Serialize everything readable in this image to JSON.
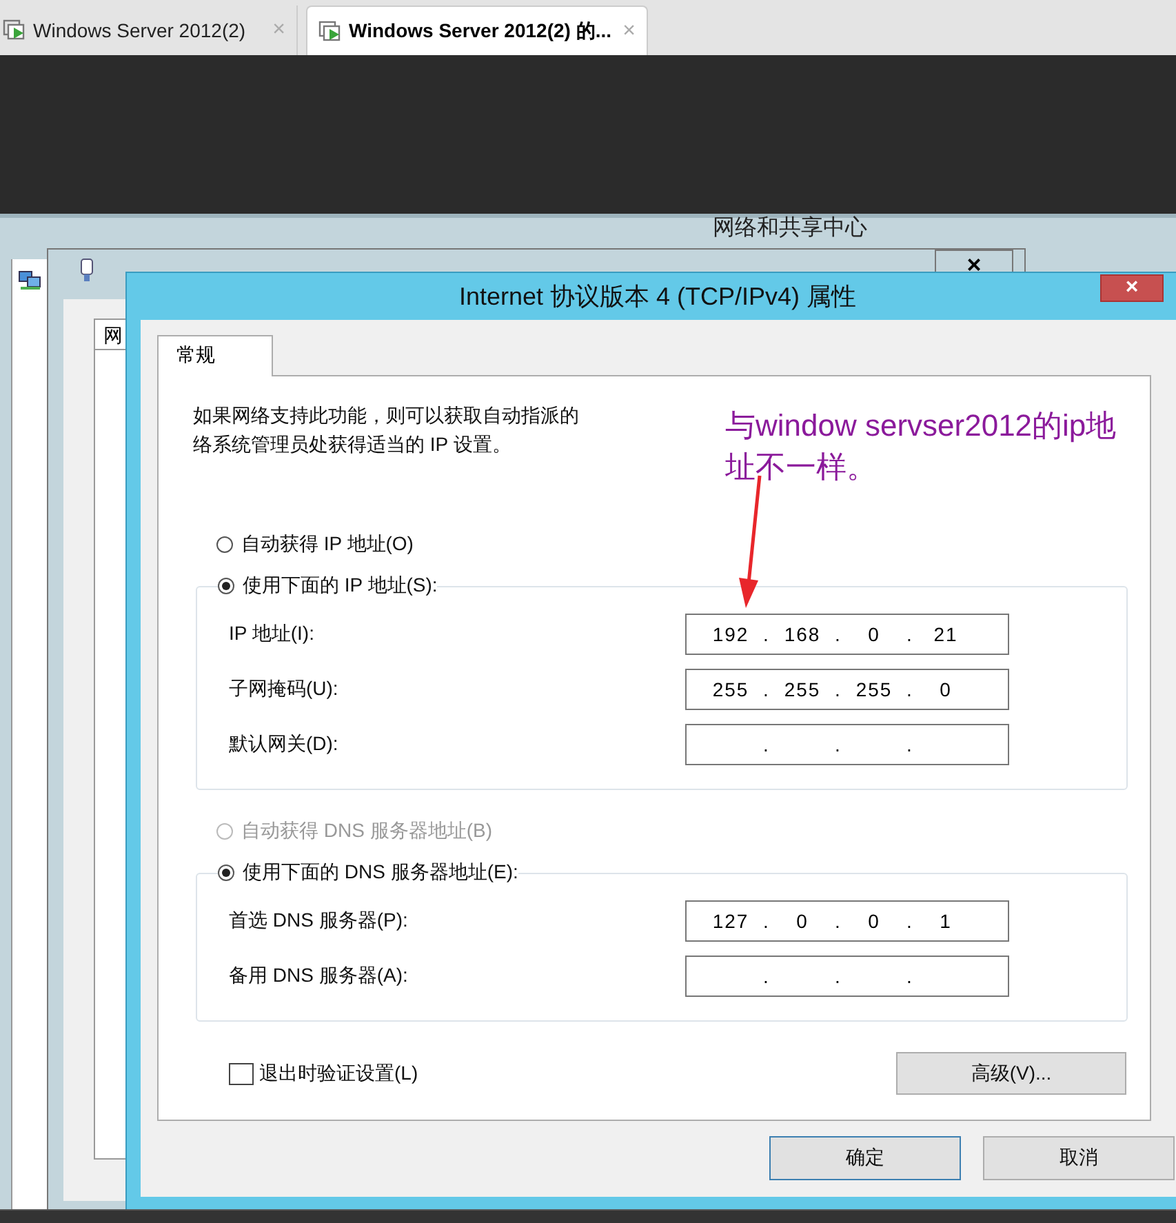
{
  "browser_tabs": [
    {
      "title": "Windows Server 2012(2)",
      "close": "×",
      "selected": false
    },
    {
      "title": "Windows Server 2012(2) 的...",
      "close": "×",
      "selected": true
    }
  ],
  "background_window": {
    "title": "网络和共享中心"
  },
  "ethernet_window": {
    "close": "×",
    "tab": "网"
  },
  "dialog": {
    "title": "Internet 协议版本 4 (TCP/IPv4) 属性",
    "close": "×",
    "tabs": [
      {
        "label": "常规",
        "selected": true
      }
    ],
    "description_lines": [
      "如果网络支持此功能，则可以获取自动指派的",
      "络系统管理员处获得适当的 IP 设置。"
    ],
    "sections": [
      {
        "options": [
          {
            "label": "自动获得 IP 地址(O)",
            "selected": false,
            "disabled": false
          },
          {
            "label": "使用下面的 IP 地址(S):",
            "selected": true,
            "disabled": false
          }
        ],
        "fields": [
          {
            "label": "IP 地址(I):",
            "octets": [
              "192",
              "168",
              "0",
              "21"
            ],
            "separators": [
              ".",
              ".",
              "."
            ]
          },
          {
            "label": "子网掩码(U):",
            "octets": [
              "255",
              "255",
              "255",
              "0"
            ],
            "separators": [
              ".",
              ".",
              "."
            ]
          },
          {
            "label": "默认网关(D):",
            "separators": [
              ".",
              ".",
              "."
            ]
          }
        ]
      },
      {
        "options": [
          {
            "label": "自动获得 DNS 服务器地址(B)",
            "selected": false,
            "disabled": true
          },
          {
            "label": "使用下面的 DNS 服务器地址(E):",
            "selected": true,
            "disabled": false
          }
        ],
        "fields": [
          {
            "label": "首选 DNS 服务器(P):",
            "octets": [
              "127",
              "0",
              "0",
              "1"
            ],
            "separators": [
              ".",
              ".",
              "."
            ]
          },
          {
            "label": "备用 DNS 服务器(A):",
            "separators": [
              ".",
              ".",
              "."
            ]
          }
        ]
      }
    ],
    "validate_checkbox": {
      "label": "退出时验证设置(L)",
      "checked": false
    },
    "advanced_button": "高级(V)...",
    "buttons": [
      {
        "label": "确定",
        "default": true
      },
      {
        "label": "取消",
        "default": false
      }
    ]
  },
  "annotation": {
    "text": "与window servser2012的ip地址不一样。"
  }
}
